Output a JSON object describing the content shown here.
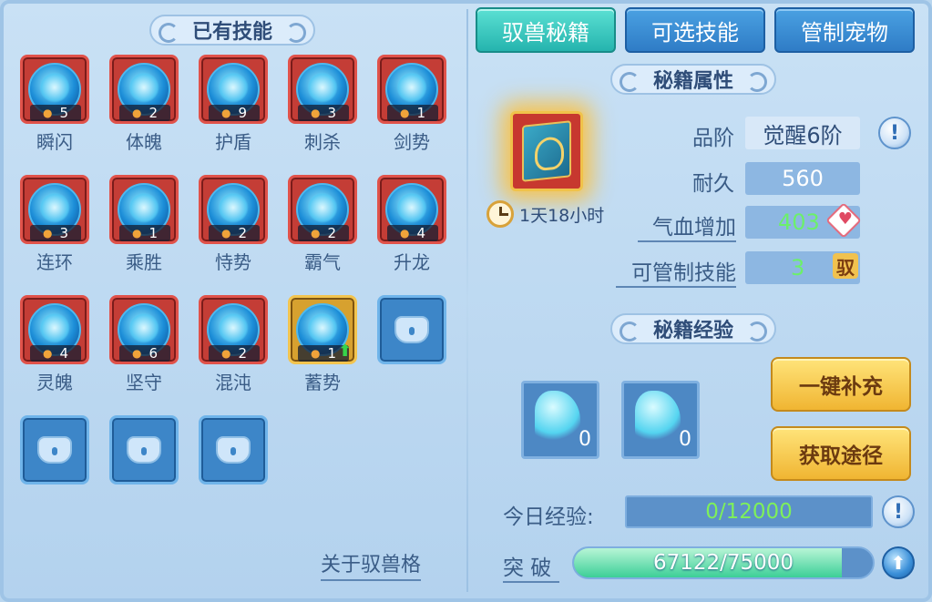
{
  "left_panel": {
    "title": "已有技能",
    "skills": [
      {
        "name": "瞬闪",
        "count": "5"
      },
      {
        "name": "体魄",
        "count": "2"
      },
      {
        "name": "护盾",
        "count": "9"
      },
      {
        "name": "刺杀",
        "count": "3"
      },
      {
        "name": "剑势",
        "count": "1"
      },
      {
        "name": "连环",
        "count": "3"
      },
      {
        "name": "乘胜",
        "count": "1"
      },
      {
        "name": "恃势",
        "count": "2"
      },
      {
        "name": "霸气",
        "count": "2"
      },
      {
        "name": "升龙",
        "count": "4"
      },
      {
        "name": "灵魄",
        "count": "4"
      },
      {
        "name": "坚守",
        "count": "6"
      },
      {
        "name": "混沌",
        "count": "2"
      },
      {
        "name": "蓄势",
        "count": "1"
      }
    ],
    "about_link": "关于驭兽格"
  },
  "tabs": [
    "驭兽秘籍",
    "可选技能",
    "管制宠物"
  ],
  "attributes": {
    "title": "秘籍属性",
    "timer": "1天18小时",
    "grade_label": "品阶",
    "grade_value": "觉醒6阶",
    "durability_label": "耐久",
    "durability_value": "560",
    "hp_label": "气血增加",
    "hp_value": "403",
    "skills_label": "可管制技能",
    "skills_value": "3",
    "skills_badge": "驭"
  },
  "experience": {
    "title": "秘籍经验",
    "items": [
      {
        "count": "0"
      },
      {
        "count": "0"
      }
    ],
    "refill_button": "一键补充",
    "obtain_button": "获取途径",
    "today_label": "今日经验:",
    "today_value": "0/12000",
    "breakthrough_label": "突 破",
    "breakthrough_value": "67122/75000",
    "breakthrough_fraction": 0.895
  }
}
